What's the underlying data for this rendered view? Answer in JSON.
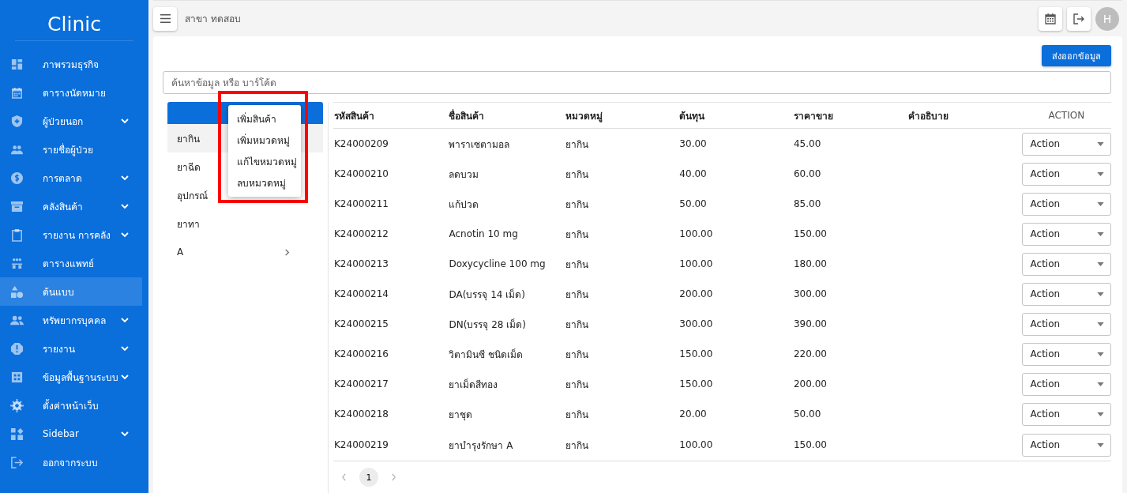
{
  "sidebar": {
    "brand": "Clinic",
    "items": [
      {
        "label": "ภาพรวมธุรกิจ",
        "expandable": false,
        "selected": false
      },
      {
        "label": "ตารางนัดหมาย",
        "expandable": false,
        "selected": false
      },
      {
        "label": "ผู้ป่วยนอก",
        "expandable": true,
        "selected": false
      },
      {
        "label": "รายชื่อผู้ป่วย",
        "expandable": false,
        "selected": false
      },
      {
        "label": "การตลาด",
        "expandable": true,
        "selected": false
      },
      {
        "label": "คลังสินค้า",
        "expandable": true,
        "selected": false
      },
      {
        "label": "รายงาน การคลัง",
        "expandable": true,
        "selected": false
      },
      {
        "label": "ตารางแพทย์",
        "expandable": false,
        "selected": false
      },
      {
        "label": "ต้นแบบ",
        "expandable": false,
        "selected": true
      },
      {
        "label": "ทรัพยากรบุคคล",
        "expandable": true,
        "selected": false
      },
      {
        "label": "รายงาน",
        "expandable": true,
        "selected": false
      },
      {
        "label": "ข้อมูลพื้นฐานระบบ",
        "expandable": true,
        "selected": false
      },
      {
        "label": "ตั้งค่าหน้าเว็บ",
        "expandable": false,
        "selected": false
      },
      {
        "label": "Sidebar",
        "expandable": true,
        "selected": false
      },
      {
        "label": "ออกจากระบบ",
        "expandable": false,
        "selected": false
      }
    ]
  },
  "topbar": {
    "branch": "สาขา ทดสอบ",
    "avatar": "H"
  },
  "export_button": "ส่งออกข้อมูล",
  "search": {
    "placeholder": "ค้นหาข้อมูล หรือ บาร์โค้ด"
  },
  "categories": [
    {
      "label": "ยากิน",
      "selected": true,
      "expandable": false
    },
    {
      "label": "ยาฉีด",
      "selected": false,
      "expandable": false
    },
    {
      "label": "อุปกรณ์",
      "selected": false,
      "expandable": false
    },
    {
      "label": "ยาทา",
      "selected": false,
      "expandable": false
    },
    {
      "label": "A",
      "selected": false,
      "expandable": true
    }
  ],
  "context_menu": [
    "เพิ่มสินค้า",
    "เพิ่มหมวดหมู่",
    "แก้ไขหมวดหมู่",
    "ลบหมวดหมู่"
  ],
  "table": {
    "columns": [
      "รหัสสินค้า",
      "ชื่อสินค้า",
      "หมวดหมู่",
      "ต้นทุน",
      "ราคาขาย",
      "คำอธิบาย",
      "ACTION"
    ],
    "rows": [
      {
        "code": "K24000209",
        "name": "พาราเซตามอล",
        "category": "ยากิน",
        "cost": "30.00",
        "price": "45.00",
        "action": "Action"
      },
      {
        "code": "K24000210",
        "name": "ลดบวม",
        "category": "ยากิน",
        "cost": "40.00",
        "price": "60.00",
        "action": "Action"
      },
      {
        "code": "K24000211",
        "name": "แก้ปวด",
        "category": "ยากิน",
        "cost": "50.00",
        "price": "85.00",
        "action": "Action"
      },
      {
        "code": "K24000212",
        "name": "Acnotin 10 mg",
        "category": "ยากิน",
        "cost": "100.00",
        "price": "150.00",
        "action": "Action"
      },
      {
        "code": "K24000213",
        "name": "Doxycycline 100 mg",
        "category": "ยากิน",
        "cost": "100.00",
        "price": "180.00",
        "action": "Action"
      },
      {
        "code": "K24000214",
        "name": "DA(บรรจุ 14 เม็ด)",
        "category": "ยากิน",
        "cost": "200.00",
        "price": "300.00",
        "action": "Action"
      },
      {
        "code": "K24000215",
        "name": "DN(บรรจุ 28 เม็ด)",
        "category": "ยากิน",
        "cost": "300.00",
        "price": "390.00",
        "action": "Action"
      },
      {
        "code": "K24000216",
        "name": "วิตามินซี ชนิดเม็ด",
        "category": "ยากิน",
        "cost": "150.00",
        "price": "220.00",
        "action": "Action"
      },
      {
        "code": "K24000217",
        "name": "ยาเม็ดสีทอง",
        "category": "ยากิน",
        "cost": "150.00",
        "price": "200.00",
        "action": "Action"
      },
      {
        "code": "K24000218",
        "name": "ยาชุด",
        "category": "ยากิน",
        "cost": "20.00",
        "price": "50.00",
        "action": "Action"
      },
      {
        "code": "K24000219",
        "name": "ยาบำรุงรักษา A",
        "category": "ยากิน",
        "cost": "100.00",
        "price": "150.00",
        "action": "Action"
      }
    ]
  },
  "pagination": {
    "pages": [
      {
        "label": "1",
        "selected": true
      }
    ]
  }
}
